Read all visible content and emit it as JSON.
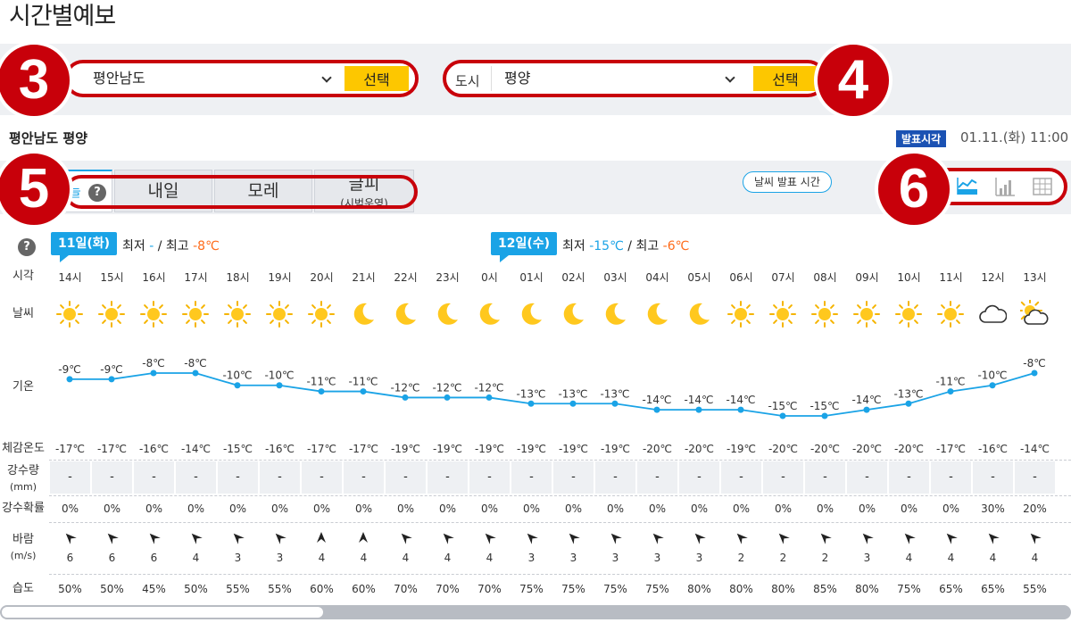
{
  "page": {
    "title": "시간별예보"
  },
  "filters": {
    "province": {
      "value": "평안남도",
      "button": "선택"
    },
    "city": {
      "label": "도시",
      "value": "평양",
      "button": "선택"
    }
  },
  "badges": [
    "3",
    "4",
    "5",
    "6"
  ],
  "location": {
    "title": "평안남도 평양",
    "announce_tag": "발표시각",
    "announce_time": "01.11.(화) 11:00"
  },
  "tabs": {
    "today": "늘",
    "tomorrow": "내일",
    "after": "모레",
    "more": "글피",
    "more_sub": "(시범운영)",
    "help": "?",
    "announce_button": "날씨 발표 시간"
  },
  "view_icons": [
    "line-chart-icon",
    "bar-chart-icon",
    "table-icon"
  ],
  "help_icon": "?",
  "days": [
    {
      "tag": "11일(화)",
      "min_label": "최저",
      "min": "-",
      "sep": "/",
      "max_label": "최고",
      "max": "-8℃"
    },
    {
      "tag": "12일(수)",
      "min_label": "최저",
      "min": "-15℃",
      "sep": "/",
      "max_label": "최고",
      "max": "-6℃"
    }
  ],
  "row_labels": {
    "time": "시각",
    "weather": "날씨",
    "temp": "기온",
    "feels": "체감온도",
    "rain": "강수량",
    "rain_unit": "(mm)",
    "prob": "강수확률",
    "wind": "바람",
    "wind_unit": "(m/s)",
    "humidity": "습도"
  },
  "colors": {
    "accent": "#1aa3e6",
    "highlight": "#c8000a",
    "button": "#fdc700",
    "max": "#ff6b1a"
  },
  "hours": [
    {
      "time": "14시",
      "icon": "sun",
      "temp": -9,
      "temp_label": "-9℃",
      "feels": "-17℃",
      "rain": "-",
      "prob": "0%",
      "wind_dir": 135,
      "wind": "6",
      "hum": "50%"
    },
    {
      "time": "15시",
      "icon": "sun",
      "temp": -9,
      "temp_label": "-9℃",
      "feels": "-17℃",
      "rain": "-",
      "prob": "0%",
      "wind_dir": 135,
      "wind": "6",
      "hum": "50%"
    },
    {
      "time": "16시",
      "icon": "sun",
      "temp": -8,
      "temp_label": "-8℃",
      "feels": "-16℃",
      "rain": "-",
      "prob": "0%",
      "wind_dir": 135,
      "wind": "6",
      "hum": "45%"
    },
    {
      "time": "17시",
      "icon": "sun",
      "temp": -8,
      "temp_label": "-8℃",
      "feels": "-14℃",
      "rain": "-",
      "prob": "0%",
      "wind_dir": 135,
      "wind": "4",
      "hum": "50%"
    },
    {
      "time": "18시",
      "icon": "sun",
      "temp": -10,
      "temp_label": "-10℃",
      "feels": "-15℃",
      "rain": "-",
      "prob": "0%",
      "wind_dir": 135,
      "wind": "3",
      "hum": "55%"
    },
    {
      "time": "19시",
      "icon": "sun",
      "temp": -10,
      "temp_label": "-10℃",
      "feels": "-16℃",
      "rain": "-",
      "prob": "0%",
      "wind_dir": 135,
      "wind": "3",
      "hum": "55%"
    },
    {
      "time": "20시",
      "icon": "sun",
      "temp": -11,
      "temp_label": "-11℃",
      "feels": "-17℃",
      "rain": "-",
      "prob": "0%",
      "wind_dir": 180,
      "wind": "4",
      "hum": "60%"
    },
    {
      "time": "21시",
      "icon": "moon",
      "temp": -11,
      "temp_label": "-11℃",
      "feels": "-17℃",
      "rain": "-",
      "prob": "0%",
      "wind_dir": 180,
      "wind": "4",
      "hum": "60%"
    },
    {
      "time": "22시",
      "icon": "moon",
      "temp": -12,
      "temp_label": "-12℃",
      "feels": "-19℃",
      "rain": "-",
      "prob": "0%",
      "wind_dir": 135,
      "wind": "4",
      "hum": "70%"
    },
    {
      "time": "23시",
      "icon": "moon",
      "temp": -12,
      "temp_label": "-12℃",
      "feels": "-19℃",
      "rain": "-",
      "prob": "0%",
      "wind_dir": 135,
      "wind": "4",
      "hum": "70%"
    },
    {
      "time": "0시",
      "icon": "moon",
      "temp": -12,
      "temp_label": "-12℃",
      "feels": "-19℃",
      "rain": "-",
      "prob": "0%",
      "wind_dir": 135,
      "wind": "4",
      "hum": "70%"
    },
    {
      "time": "01시",
      "icon": "moon",
      "temp": -13,
      "temp_label": "-13℃",
      "feels": "-19℃",
      "rain": "-",
      "prob": "0%",
      "wind_dir": 135,
      "wind": "3",
      "hum": "75%"
    },
    {
      "time": "02시",
      "icon": "moon",
      "temp": -13,
      "temp_label": "-13℃",
      "feels": "-19℃",
      "rain": "-",
      "prob": "0%",
      "wind_dir": 135,
      "wind": "3",
      "hum": "75%"
    },
    {
      "time": "03시",
      "icon": "moon",
      "temp": -13,
      "temp_label": "-13℃",
      "feels": "-19℃",
      "rain": "-",
      "prob": "0%",
      "wind_dir": 135,
      "wind": "3",
      "hum": "75%"
    },
    {
      "time": "04시",
      "icon": "moon",
      "temp": -14,
      "temp_label": "-14℃",
      "feels": "-20℃",
      "rain": "-",
      "prob": "0%",
      "wind_dir": 135,
      "wind": "3",
      "hum": "75%"
    },
    {
      "time": "05시",
      "icon": "moon",
      "temp": -14,
      "temp_label": "-14℃",
      "feels": "-20℃",
      "rain": "-",
      "prob": "0%",
      "wind_dir": 135,
      "wind": "3",
      "hum": "80%"
    },
    {
      "time": "06시",
      "icon": "sun",
      "temp": -14,
      "temp_label": "-14℃",
      "feels": "-19℃",
      "rain": "-",
      "prob": "0%",
      "wind_dir": 135,
      "wind": "2",
      "hum": "80%"
    },
    {
      "time": "07시",
      "icon": "sun",
      "temp": -15,
      "temp_label": "-15℃",
      "feels": "-20℃",
      "rain": "-",
      "prob": "0%",
      "wind_dir": 135,
      "wind": "2",
      "hum": "80%"
    },
    {
      "time": "08시",
      "icon": "sun",
      "temp": -15,
      "temp_label": "-15℃",
      "feels": "-20℃",
      "rain": "-",
      "prob": "0%",
      "wind_dir": 135,
      "wind": "2",
      "hum": "85%"
    },
    {
      "time": "09시",
      "icon": "sun",
      "temp": -14,
      "temp_label": "-14℃",
      "feels": "-20℃",
      "rain": "-",
      "prob": "0%",
      "wind_dir": 135,
      "wind": "3",
      "hum": "80%"
    },
    {
      "time": "10시",
      "icon": "sun",
      "temp": -13,
      "temp_label": "-13℃",
      "feels": "-20℃",
      "rain": "-",
      "prob": "0%",
      "wind_dir": 135,
      "wind": "4",
      "hum": "75%"
    },
    {
      "time": "11시",
      "icon": "sun",
      "temp": -11,
      "temp_label": "-11℃",
      "feels": "-17℃",
      "rain": "-",
      "prob": "0%",
      "wind_dir": 135,
      "wind": "4",
      "hum": "65%"
    },
    {
      "time": "12시",
      "icon": "cloud",
      "temp": -10,
      "temp_label": "-10℃",
      "feels": "-16℃",
      "rain": "-",
      "prob": "30%",
      "wind_dir": 135,
      "wind": "4",
      "hum": "65%"
    },
    {
      "time": "13시",
      "icon": "sun-cloud",
      "temp": -8,
      "temp_label": "-8℃",
      "feels": "-14℃",
      "rain": "-",
      "prob": "20%",
      "wind_dir": 135,
      "wind": "4",
      "hum": "55%"
    }
  ]
}
